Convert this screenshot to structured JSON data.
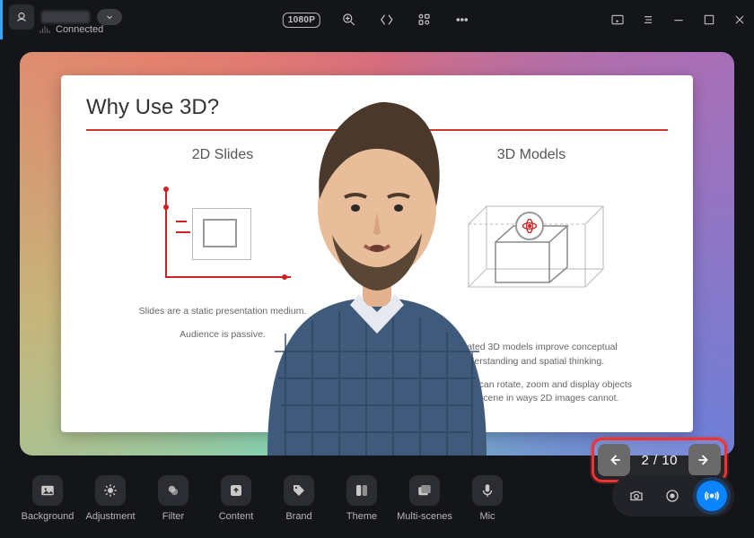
{
  "titlebar": {
    "connected_label": "Connected",
    "resolution_badge": "1080P"
  },
  "slide": {
    "title": "Why Use 3D?",
    "col_left_heading": "2D Slides",
    "col_right_heading": "3D Models",
    "cap_left_1": "Slides are a static presentation medium.",
    "cap_left_2": "Audience is passive.",
    "cap_right_1": "Animated 3D models improve conceptual understanding and spatial thinking.",
    "cap_right_2": "Presenters can rotate, zoom and display objects within a scene in ways 2D images cannot."
  },
  "nav": {
    "counter": "2 / 10"
  },
  "tools": {
    "background": "Background",
    "adjustment": "Adjustment",
    "filter": "Filter",
    "content": "Content",
    "brand": "Brand",
    "theme": "Theme",
    "multiscenes": "Multi-scenes",
    "mic": "Mic"
  }
}
